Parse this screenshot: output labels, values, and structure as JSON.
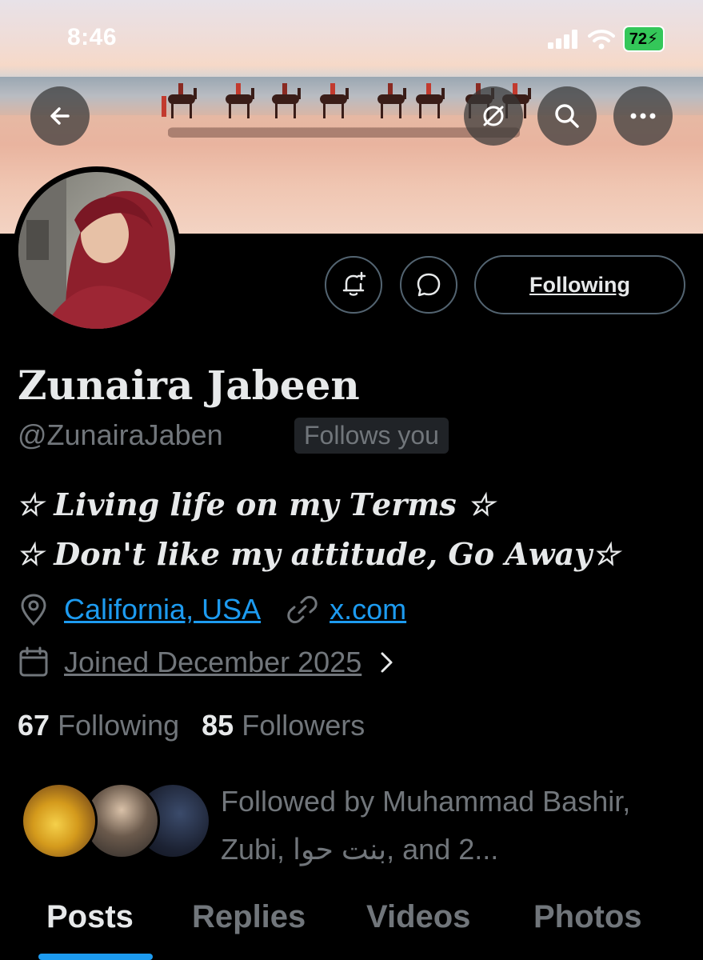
{
  "status_bar": {
    "time": "8:46",
    "battery": "72"
  },
  "icons": {
    "back": "arrow-left-icon",
    "grok": "grok-icon",
    "search": "search-icon",
    "more": "more-icon",
    "notify": "bell-plus-icon",
    "message": "message-icon",
    "location": "location-icon",
    "link": "link-icon",
    "calendar": "calendar-icon",
    "chevron": "chevron-right-icon"
  },
  "profile": {
    "following_button": "Following",
    "name": "Zunaira Jabeen",
    "handle": "@ZunairaJaben",
    "follows_you": "Follows you",
    "bio_line1": "☆ 𝑳𝒊𝒗𝒊𝒏𝒈 𝒍𝒊𝒇𝒆 𝒐𝒏 𝒎𝒚 𝑻𝒆𝒓𝒎𝒔 ☆",
    "bio_line2": "☆ 𝑫𝒐𝒏'𝒕 𝒍𝒊𝒌𝒆 𝒎𝒚 𝒂𝒕𝒕𝒊𝒕𝒖𝒅𝒆, 𝑮𝒐 𝑨𝒘𝒂𝒚☆",
    "location": "California, USA",
    "website": "x.com",
    "joined": "Joined December 2025",
    "following_count": "67",
    "following_label": "Following",
    "followers_count": "85",
    "followers_label": "Followers",
    "followed_by": "Followed by Muhammad Bashir, Zubi, بنت حوا, and 2..."
  },
  "tabs": [
    {
      "label": "Posts",
      "active": true
    },
    {
      "label": "Replies",
      "active": false
    },
    {
      "label": "Videos",
      "active": false
    },
    {
      "label": "Photos",
      "active": false
    }
  ],
  "colors": {
    "accent": "#1d9bf0",
    "muted": "#71767b",
    "background": "#000000"
  }
}
